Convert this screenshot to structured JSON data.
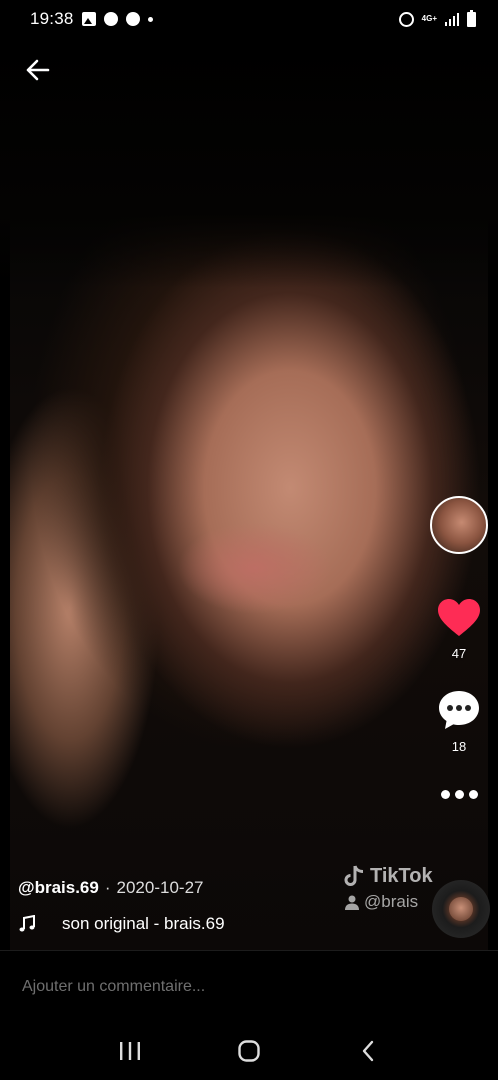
{
  "status_bar": {
    "time": "19:38",
    "network": "4G+",
    "icons": [
      "gallery-icon",
      "messenger-icon",
      "messenger-icon",
      "notification-dot",
      "alarm-icon",
      "signal-icon",
      "battery-icon"
    ]
  },
  "video": {
    "author": "@brais.69",
    "separator": "·",
    "date": "2020-10-27",
    "sound": "son original - brais.69",
    "likes": "47",
    "comments": "18",
    "like_color": "#fe2c55",
    "watermark_logo": "TikTok",
    "watermark_handle": "@brais"
  },
  "comment_bar": {
    "placeholder": "Ajouter un commentaire..."
  },
  "nav": {
    "icons": [
      "recents-icon",
      "home-icon",
      "back-icon"
    ]
  }
}
